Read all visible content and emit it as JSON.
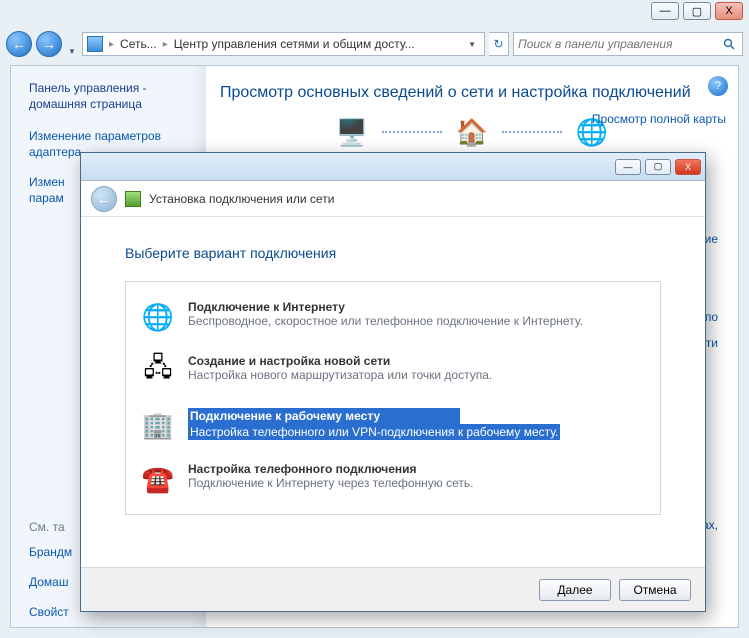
{
  "titlebar": {
    "min": "—",
    "max": "▢",
    "close": "X"
  },
  "toolbar": {
    "back": "←",
    "forward": "→",
    "crumb1": "Сеть...",
    "crumb2": "Центр управления сетями и общим досту...",
    "refresh": "↻",
    "search_placeholder": "Поиск в панели управления"
  },
  "sidebar": {
    "home": "Панель управления - домашняя страница",
    "link1": "Изменение параметров адаптера",
    "link2_a": "Измен",
    "link2_b": "парам",
    "seealso": "См. та",
    "see1": "Брандм",
    "see2": "Домаш",
    "see3": "Свойст"
  },
  "content": {
    "heading": "Просмотр основных сведений о сети и настройка подключений",
    "maplink": "Просмотр полной карты",
    "r1": "чение",
    "r2": "е по",
    "r3": "ети",
    "r4": "терах,"
  },
  "wizard": {
    "title": "Установка подключения или сети",
    "heading": "Выберите вариант подключения",
    "options": [
      {
        "title": "Подключение к Интернету",
        "desc": "Беспроводное, скоростное или телефонное подключение к Интернету."
      },
      {
        "title": "Создание и настройка новой сети",
        "desc": "Настройка нового маршрутизатора или точки доступа."
      },
      {
        "title": "Подключение к рабочему месту",
        "desc": "Настройка телефонного или VPN-подключения к рабочему месту."
      },
      {
        "title": "Настройка телефонного подключения",
        "desc": "Подключение к Интернету через телефонную сеть."
      }
    ],
    "next": "Далее",
    "cancel": "Отмена"
  }
}
